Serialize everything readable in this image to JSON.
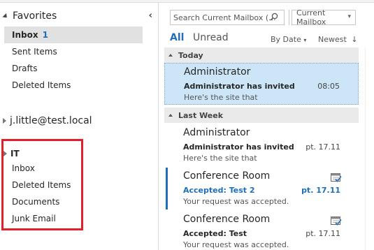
{
  "sidebar": {
    "favorites_title": "Favorites",
    "favorites": [
      {
        "label": "Inbox",
        "count": "1"
      },
      {
        "label": "Sent Items"
      },
      {
        "label": "Drafts"
      },
      {
        "label": "Deleted Items"
      }
    ],
    "account": "j.little@test.local",
    "shared_folder": {
      "title": "IT",
      "items": [
        "Inbox",
        "Deleted Items",
        "Documents",
        "Junk Email"
      ]
    }
  },
  "search": {
    "placeholder": "Search Current Mailbox (...",
    "scope": "Current Mailbox"
  },
  "filters": {
    "all": "All",
    "unread": "Unread",
    "sort_by": "By Date",
    "sort_order": "Newest"
  },
  "groups": [
    {
      "label": "Today"
    },
    {
      "label": "Last Week"
    }
  ],
  "messages": [
    {
      "sender": "Administrator",
      "subject": "Administrator has invited y...",
      "preview": "Here's the site that",
      "date": "08:05"
    },
    {
      "sender": "Administrator",
      "subject": "Administrator has invited y...",
      "preview": "Here's the site that",
      "date": "pt. 17.11"
    },
    {
      "sender": "Conference Room",
      "subject": "Accepted: Test 2",
      "preview": "Your request was accepted.",
      "date": "pt. 17.11"
    },
    {
      "sender": "Conference Room",
      "subject": "Accepted: Test",
      "preview": "Your request was accepted.",
      "date": "pt. 17.11"
    }
  ],
  "colors": {
    "accent": "#1e6fb8",
    "selection": "#cde6f7",
    "highlight_box": "#e0202a"
  }
}
